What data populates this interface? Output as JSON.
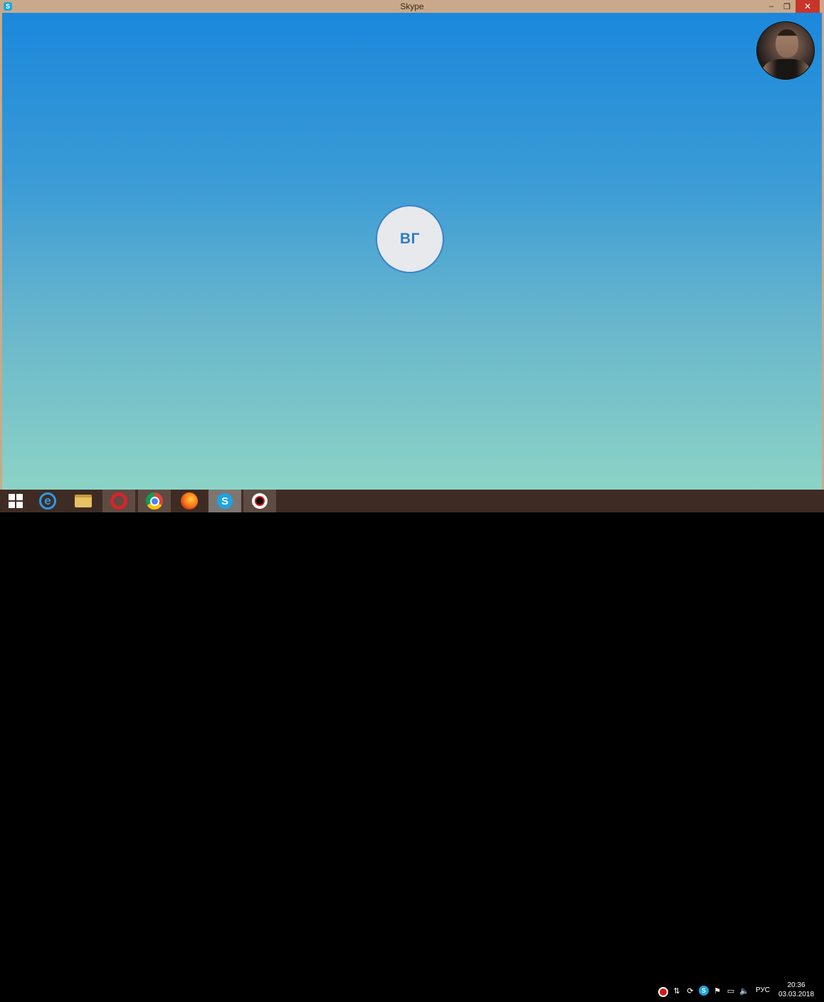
{
  "window": {
    "title": "Skype",
    "app_icon": "skype-icon",
    "controls": {
      "minimize": "–",
      "maximize": "❐",
      "close": "✕"
    }
  },
  "call": {
    "contact_initials": "ВГ",
    "self_view": "self-video-preview"
  },
  "taskbar": {
    "apps": [
      "start",
      "internet-explorer",
      "file-explorer",
      "opera",
      "chrome",
      "firefox",
      "skype",
      "screen-recorder"
    ],
    "active_app": "skype",
    "tray_icons": [
      "recorder-tray-icon",
      "network-activity-icon",
      "sync-icon",
      "skype-tray-icon",
      "flag-icon",
      "network-icon",
      "volume-icon"
    ],
    "language": "РУС",
    "time": "20:36",
    "date": "03.03.2018"
  },
  "colors": {
    "gradient_top": "#1b88dc",
    "gradient_bottom": "#8cd3c6",
    "initials_color": "#2e7cc3",
    "titlebar": "#c9a98a",
    "taskbar": "#3e2c24"
  }
}
